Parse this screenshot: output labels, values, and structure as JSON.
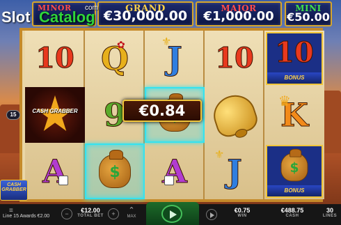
{
  "jackpots": {
    "minor": {
      "label": "MINOR",
      "value": ""
    },
    "grand": {
      "label": "GRAND",
      "value": "€30,000.00"
    },
    "major": {
      "label": "MAJOR",
      "value": "€1,000.00"
    },
    "mini": {
      "label": "MINI",
      "value": "€50.00"
    }
  },
  "watermark": {
    "slot": "Slot",
    "catalog": "Catalog",
    "com": "com"
  },
  "reels": [
    [
      "10",
      "CASH GRABBER",
      "A"
    ],
    [
      "Q",
      "9",
      "money-bag"
    ],
    [
      "J",
      "money-bag",
      "A"
    ],
    [
      "10",
      "bell",
      "J"
    ],
    [
      "10 BONUS",
      "K",
      "money-bag BONUS"
    ]
  ],
  "win_amount": "€0.84",
  "line_marker": "15",
  "bonus_band": "BONUS",
  "cash_grabber_label": "CASH GRABBER",
  "side_badge": "CASH GRABBER",
  "bottom": {
    "status": "Line 15 Awards €2.00",
    "total_bet": {
      "value": "€12.00",
      "label": "TOTAL BET"
    },
    "max_label": "MAX",
    "win": {
      "value": "€0.75",
      "label": "WIN"
    },
    "cash": {
      "value": "€488.75",
      "label": "CASH"
    },
    "lines": {
      "value": "30",
      "label": "LINES"
    }
  },
  "colors": {
    "frame": "#c58a2a",
    "highlight": "#36e2ef",
    "jackpot_bg": "#1b2a6e"
  }
}
